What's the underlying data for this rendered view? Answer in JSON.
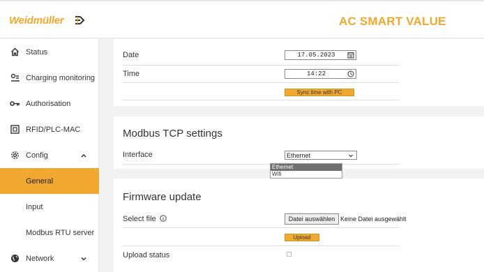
{
  "header": {
    "brand": "Weidmüller",
    "title": "AC SMART VALUE"
  },
  "colors": {
    "accent": "#f0a830",
    "background": "#f2f2f2",
    "dropdown_selected": "#6f6f6f"
  },
  "sidebar": {
    "items": [
      {
        "label": "Status",
        "icon": "home-icon"
      },
      {
        "label": "Charging monitoring",
        "icon": "charging-icon"
      },
      {
        "label": "Authorisation",
        "icon": "key-icon"
      },
      {
        "label": "RFID/PLC-MAC",
        "icon": "rfid-icon"
      },
      {
        "label": "Config",
        "icon": "gear-icon",
        "expanded": true
      },
      {
        "label": "General",
        "active": true
      },
      {
        "label": "Input"
      },
      {
        "label": "Modbus RTU server"
      },
      {
        "label": "Network",
        "icon": "globe-icon",
        "expanded": false
      }
    ]
  },
  "time_settings": {
    "date_label": "Date",
    "date_value": "17.05.2023",
    "time_label": "Time",
    "time_value": "14:22",
    "sync_button": "Sync time with PC"
  },
  "modbus": {
    "title": "Modbus TCP settings",
    "interface_label": "Interface",
    "interface_value": "Ethernet",
    "options": [
      "Ethernet",
      "Wifi"
    ]
  },
  "firmware": {
    "title": "Firmware update",
    "select_file_label": "Select file",
    "choose_file_button": "Datei auswählen",
    "no_file_text": "Keine Datei ausgewählt",
    "upload_button": "Upload",
    "upload_status_label": "Upload status",
    "upload_status_checked": false
  }
}
